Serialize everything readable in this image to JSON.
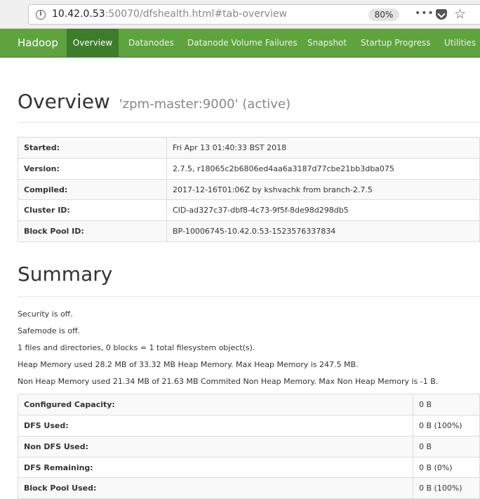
{
  "browser": {
    "url_host": "10.42.0.53",
    "url_rest": ":50070/dfshealth.html#tab-overview",
    "zoom": "80%"
  },
  "nav": {
    "brand": "Hadoop",
    "items": [
      "Overview",
      "Datanodes",
      "Datanode Volume Failures",
      "Snapshot",
      "Startup Progress",
      "Utilities"
    ]
  },
  "overview": {
    "title": "Overview",
    "subtitle": "'zpm-master:9000' (active)",
    "rows": [
      {
        "k": "Started:",
        "v": "Fri Apr 13 01:40:33 BST 2018"
      },
      {
        "k": "Version:",
        "v": "2.7.5, r18065c2b6806ed4aa6a3187d77cbe21bb3dba075"
      },
      {
        "k": "Compiled:",
        "v": "2017-12-16T01:06Z by kshvachk from branch-2.7.5"
      },
      {
        "k": "Cluster ID:",
        "v": "CID-ad327c37-dbf8-4c73-9f5f-8de98d298db5"
      },
      {
        "k": "Block Pool ID:",
        "v": "BP-10006745-10.42.0.53-1523576337834"
      }
    ]
  },
  "summary": {
    "title": "Summary",
    "lines": [
      "Security is off.",
      "Safemode is off.",
      "1 files and directories, 0 blocks = 1 total filesystem object(s).",
      "Heap Memory used 28.2 MB of 33.32 MB Heap Memory. Max Heap Memory is 247.5 MB.",
      "Non Heap Memory used 21.34 MB of 21.63 MB Commited Non Heap Memory. Max Non Heap Memory is -1 B."
    ],
    "rows": [
      {
        "k": "Configured Capacity:",
        "v": "0 B"
      },
      {
        "k": "DFS Used:",
        "v": "0 B (100%)"
      },
      {
        "k": "Non DFS Used:",
        "v": "0 B"
      },
      {
        "k": "DFS Remaining:",
        "v": "0 B (0%)"
      },
      {
        "k": "Block Pool Used:",
        "v": "0 B (100%)"
      }
    ]
  }
}
